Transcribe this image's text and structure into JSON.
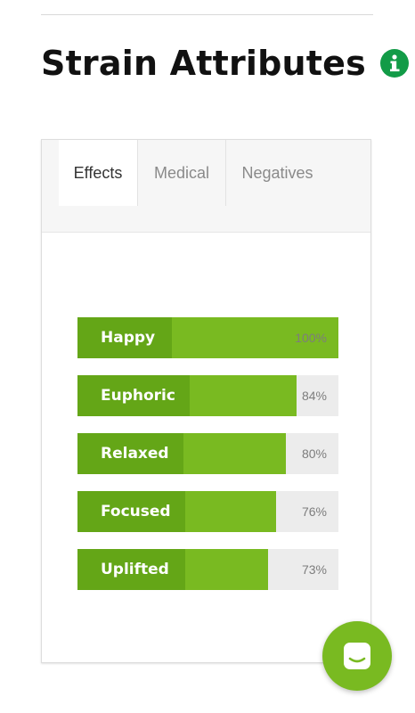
{
  "section": {
    "title": "Strain Attributes",
    "info_icon": "info-icon"
  },
  "tabs": [
    {
      "label": "Effects",
      "active": true
    },
    {
      "label": "Medical",
      "active": false
    },
    {
      "label": "Negatives",
      "active": false
    }
  ],
  "effects": [
    {
      "label": "Happy",
      "percent": 100,
      "percent_text": "100%"
    },
    {
      "label": "Euphoric",
      "percent": 84,
      "percent_text": "84%"
    },
    {
      "label": "Relaxed",
      "percent": 80,
      "percent_text": "80%"
    },
    {
      "label": "Focused",
      "percent": 76,
      "percent_text": "76%"
    },
    {
      "label": "Uplifted",
      "percent": 73,
      "percent_text": "73%"
    }
  ],
  "colors": {
    "bar_fill": "#79ba21",
    "bar_label_bg": "#64a617",
    "bar_track": "#ececec",
    "info_icon": "#129b47",
    "chat_button": "#79ba21"
  },
  "chat": {
    "icon": "chat-icon"
  }
}
